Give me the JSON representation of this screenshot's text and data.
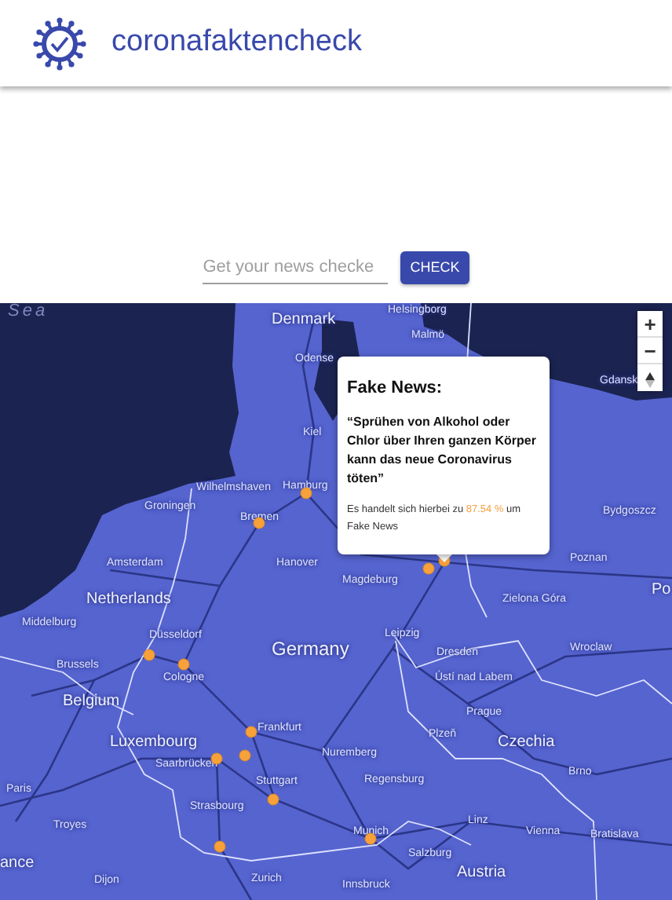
{
  "header": {
    "title": "coronafaktencheck"
  },
  "search": {
    "placeholder": "Get your news checke",
    "button": "CHECK"
  },
  "map": {
    "labels": [
      {
        "text": "Sea",
        "kind": "sea"
      },
      {
        "text": "Denmark",
        "kind": "country"
      },
      {
        "text": "Helsingborg",
        "kind": "city"
      },
      {
        "text": "Malmö",
        "kind": "city"
      },
      {
        "text": "Odense",
        "kind": "city"
      },
      {
        "text": "Kiel",
        "kind": "city"
      },
      {
        "text": "Wilhelmshaven",
        "kind": "city"
      },
      {
        "text": "Hamburg",
        "kind": "city"
      },
      {
        "text": "Groningen",
        "kind": "city"
      },
      {
        "text": "Bremen",
        "kind": "city"
      },
      {
        "text": "Amsterdam",
        "kind": "city"
      },
      {
        "text": "Hanover",
        "kind": "city"
      },
      {
        "text": "Netherlands",
        "kind": "country"
      },
      {
        "text": "Magdeburg",
        "kind": "city"
      },
      {
        "text": "Gdansk",
        "kind": "city"
      },
      {
        "text": "Bydgoszcz",
        "kind": "city"
      },
      {
        "text": "Poznan",
        "kind": "city"
      },
      {
        "text": "Zielona Góra",
        "kind": "city"
      },
      {
        "text": "Po",
        "kind": "country"
      },
      {
        "text": "Middelburg",
        "kind": "city"
      },
      {
        "text": "Düsseldorf",
        "kind": "city"
      },
      {
        "text": "Germany",
        "kind": "country"
      },
      {
        "text": "Leipzig",
        "kind": "city"
      },
      {
        "text": "Dresden",
        "kind": "city"
      },
      {
        "text": "Wroclaw",
        "kind": "city"
      },
      {
        "text": "Cologne",
        "kind": "city"
      },
      {
        "text": "Brussels",
        "kind": "city"
      },
      {
        "text": "Belgium",
        "kind": "country"
      },
      {
        "text": "Ústí nad Labem",
        "kind": "city"
      },
      {
        "text": "Prague",
        "kind": "city"
      },
      {
        "text": "Luxembourg",
        "kind": "country"
      },
      {
        "text": "Czechia",
        "kind": "country"
      },
      {
        "text": "Frankfurt",
        "kind": "city"
      },
      {
        "text": "Plzeň",
        "kind": "city"
      },
      {
        "text": "Saarbrücken",
        "kind": "city"
      },
      {
        "text": "Nuremberg",
        "kind": "city"
      },
      {
        "text": "Regensburg",
        "kind": "city"
      },
      {
        "text": "Brno",
        "kind": "city"
      },
      {
        "text": "Stuttgart",
        "kind": "city"
      },
      {
        "text": "Strasbourg",
        "kind": "city"
      },
      {
        "text": "Paris",
        "kind": "city"
      },
      {
        "text": "Troyes",
        "kind": "city"
      },
      {
        "text": "Munich",
        "kind": "city"
      },
      {
        "text": "Linz",
        "kind": "city"
      },
      {
        "text": "Vienna",
        "kind": "city"
      },
      {
        "text": "Bratislava",
        "kind": "city"
      },
      {
        "text": "Salzburg",
        "kind": "city"
      },
      {
        "text": "Austria",
        "kind": "country"
      },
      {
        "text": "ance",
        "kind": "country"
      },
      {
        "text": "Zurich",
        "kind": "city"
      },
      {
        "text": "Innsbruck",
        "kind": "city"
      },
      {
        "text": "Dijon",
        "kind": "city"
      }
    ],
    "zoom_controls": {
      "zoom_in": "+",
      "zoom_out": "−"
    },
    "popup": {
      "title": "Fake News:",
      "quote": "“Sprühen von Alkohol oder Chlor über Ihren ganzen Körper kann das neue Coronavirus töten”",
      "verdict": {
        "prefix": "Es handelt sich hierbei zu",
        "value": "87.54 %",
        "suffix": "um Fake News"
      }
    }
  }
}
